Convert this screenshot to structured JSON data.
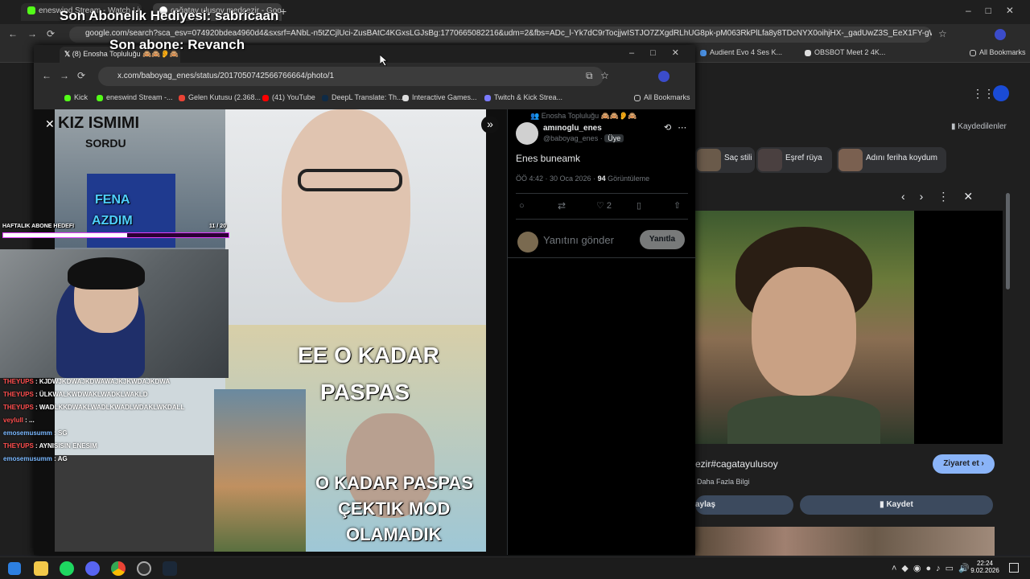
{
  "overlay": {
    "gift_text": "Son Abonelik Hediyesi: sabricaan",
    "sub_text": "Son abone: Revanch",
    "goal_label": "HAFTALIK ABONE HEDEFI",
    "goal_current": "11",
    "goal_total": "/ 20",
    "goal_progress": 0.55,
    "chat": [
      {
        "user": "THEYUPS",
        "msg": ": KJDWJKDWAJKDWAWAJKJKWDAJKDWA"
      },
      {
        "user": "THEYUPS",
        "msg": ": ÜLKWALKWDWAKLWADKLWAKLD"
      },
      {
        "user": "THEYUPS",
        "msg": ": WADLKKDWAKLWADLKWADLWDAKLWKDALL"
      },
      {
        "user": "veylull",
        "msg": ": ..."
      },
      {
        "user": "emosemusumm",
        "msg": ": SG"
      },
      {
        "user": "THEYUPS",
        "msg": ": AYNISISIN ENESIM"
      },
      {
        "user": "emosemusumm",
        "msg": ": AG"
      }
    ]
  },
  "back_browser": {
    "tabs": [
      "eneswind Stream - Watch Live",
      "çağatay ulusoy medcezir - Goo..."
    ],
    "url": "google.com/search?sca_esv=074920bdea4960d4&sxsrf=ANbL-n5tZCjlUci-ZusBAtC4KGxsLGJsBg:1770665082216&udm=2&fbs=ADc_l-Yk7dC9rTocjjwISTJO7ZXgdRLhUG8pk-pM063RkPlLfa8y8TDcNYX0oihjHX-_gadUwZ3S_EeX1FY-gWt8S1zn3NrEJVcYPC0n...",
    "bookmarks": [
      "Audient Evo 4 Ses K...",
      "OBSBOT Meet 2 4K...",
      "All Bookmarks"
    ],
    "saved_label": "Kaydedilenler",
    "chips": [
      "Saç stili",
      "Eşref rüya",
      "Adını feriha koydum"
    ],
    "caption": "ezir#cagatayulusoy",
    "more_info": "Daha Fazla Bilgi",
    "visit_btn": "Ziyaret et",
    "share_btn": "aylaş",
    "save_btn": "Kaydet"
  },
  "front_browser": {
    "tab_title": "(8) Enosha Topluluğu 🙈🙈👂🙈",
    "url": "x.com/baboyag_enes/status/2017050742566766664/photo/1",
    "bookmarks": [
      "Kick",
      "eneswind Stream -...",
      "Gelen Kutusu (2.368...",
      "(41) YouTube",
      "DeepL Translate: Th...",
      "Interactive Games...",
      "Twitch & Kick Strea...",
      "All Bookmarks"
    ]
  },
  "photo": {
    "text1": "KIZ ISMIMI",
    "text2": "SORDU",
    "text3": "FENA",
    "text4": "AZDIM",
    "text5": "EE O KADAR",
    "text6": "PASPAS",
    "text7": "O KADAR PASPAS",
    "text8": "ÇEKTIK MOD",
    "text9": "OLAMADIK"
  },
  "post": {
    "community": "Enosha Topluluğu 🙈🙈👂🙈",
    "display_name": "amınoglu_enes",
    "handle": "@baboyag_enes",
    "member_badge": "Üye",
    "text": "Enes buneamk",
    "time": "ÖÖ 4:42 · 30 Oca 2026 · ",
    "views": "94",
    "views_label": " Görüntüleme",
    "like_count": "2",
    "reply_placeholder": "Yanıtını gönder",
    "reply_btn": "Yanıtla"
  },
  "taskbar": {
    "time": "22:24",
    "date": "9.02.2026"
  }
}
